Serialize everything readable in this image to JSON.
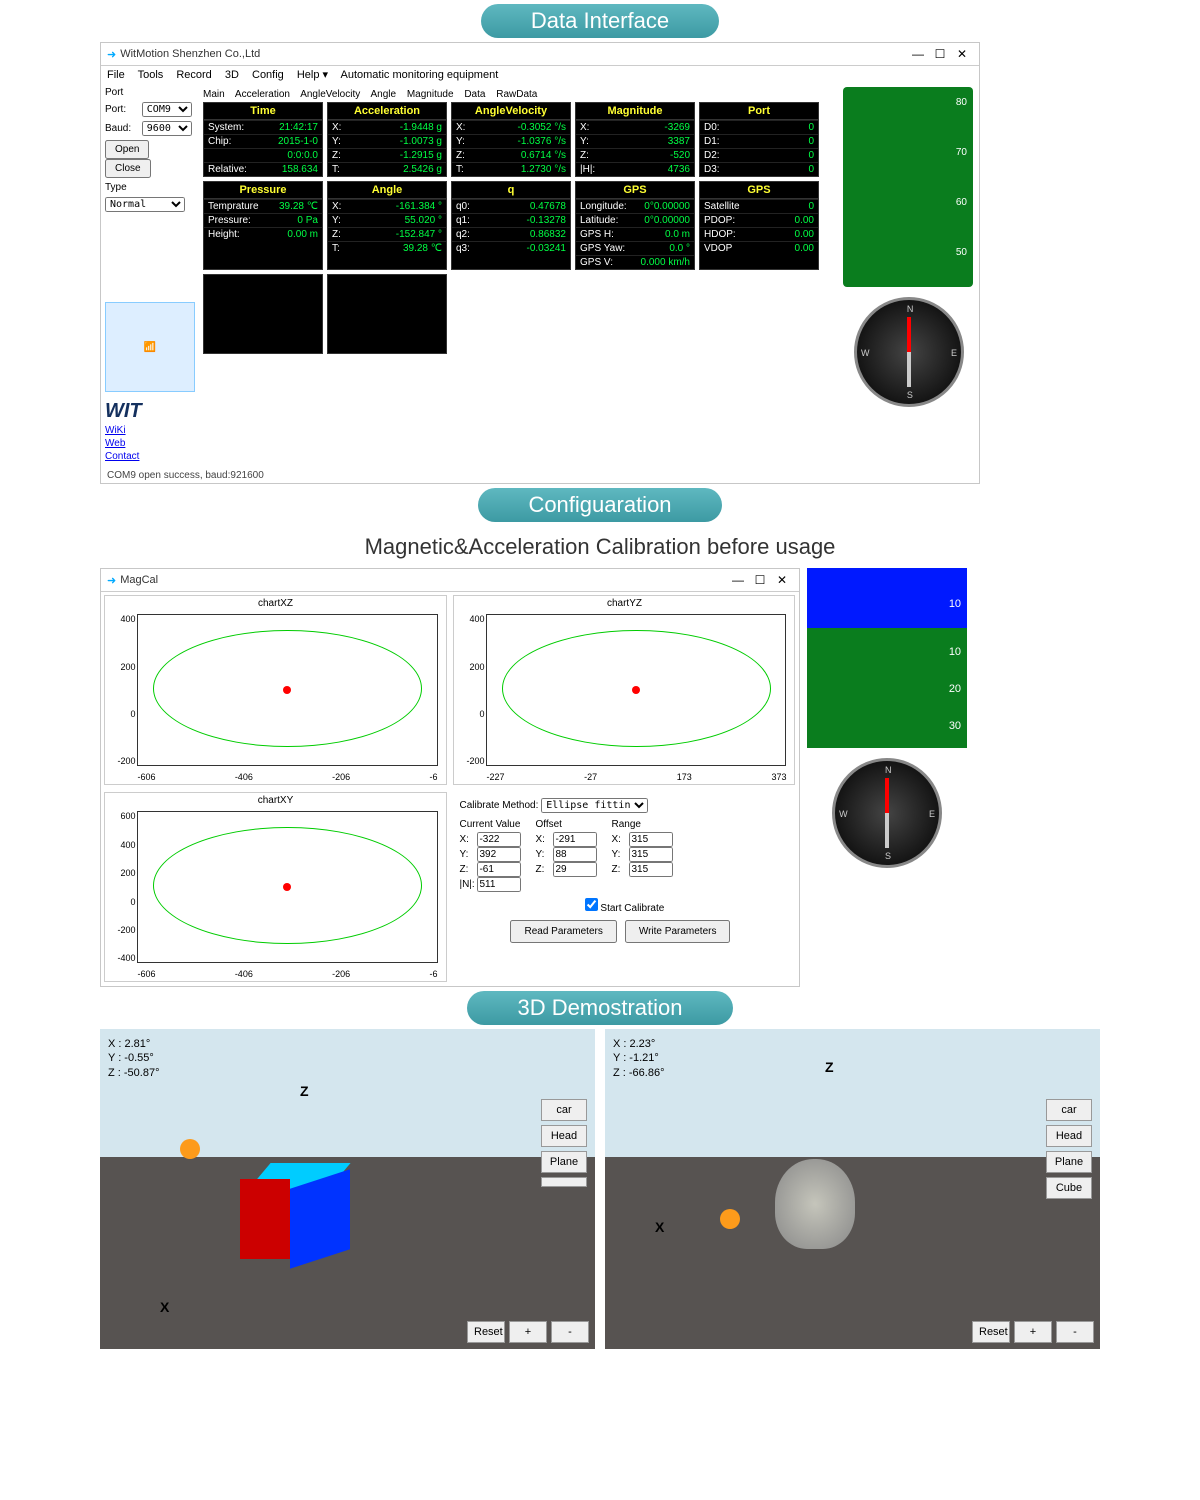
{
  "pills": {
    "data": "Data Interface",
    "config": "Configuaration",
    "demo": "3D Demostration"
  },
  "dataInterface": {
    "title": "WitMotion Shenzhen Co.,Ltd",
    "menu": [
      "File",
      "Tools",
      "Record",
      "3D",
      "Config",
      "Help ▾",
      "Automatic monitoring equipment"
    ],
    "sidebar": {
      "portLabel": "Port:",
      "port": "COM9",
      "baudLabel": "Baud:",
      "baud": "9600",
      "open": "Open",
      "close": "Close",
      "typeLabel": "Type",
      "type": "Normal",
      "wit": "WIT",
      "links": [
        "WiKi",
        "Web",
        "Contact"
      ]
    },
    "tabs": [
      "Main",
      "Acceleration",
      "AngleVelocity",
      "Angle",
      "Magnitude",
      "Data",
      "RawData"
    ],
    "panels": {
      "time": {
        "title": "Time",
        "rows": [
          [
            "System:",
            "21:42:17"
          ],
          [
            "Chip:",
            "2015-1-0"
          ],
          [
            "",
            "0:0:0.0"
          ],
          [
            "Relative:",
            "158.634"
          ]
        ]
      },
      "accel": {
        "title": "Acceleration",
        "rows": [
          [
            "X:",
            "-1.9448 g"
          ],
          [
            "Y:",
            "-1.0073 g"
          ],
          [
            "Z:",
            "-1.2915 g"
          ],
          [
            "T:",
            "2.5426 g"
          ]
        ]
      },
      "angvel": {
        "title": "AngleVelocity",
        "rows": [
          [
            "X:",
            "-0.3052 °/s"
          ],
          [
            "Y:",
            "-1.0376 °/s"
          ],
          [
            "Z:",
            "0.6714 °/s"
          ],
          [
            "T:",
            "1.2730 °/s"
          ]
        ]
      },
      "mag": {
        "title": "Magnitude",
        "rows": [
          [
            "X:",
            "-3269"
          ],
          [
            "Y:",
            "3387"
          ],
          [
            "Z:",
            "-520"
          ],
          [
            "|H|:",
            "4736"
          ]
        ]
      },
      "port": {
        "title": "Port",
        "rows": [
          [
            "D0:",
            "0"
          ],
          [
            "D1:",
            "0"
          ],
          [
            "D2:",
            "0"
          ],
          [
            "D3:",
            "0"
          ]
        ]
      },
      "pressure": {
        "title": "Pressure",
        "rows": [
          [
            "Temprature",
            "39.28 ℃"
          ],
          [
            "Pressure:",
            "0 Pa"
          ],
          [
            "Height:",
            "0.00 m"
          ]
        ]
      },
      "angle": {
        "title": "Angle",
        "rows": [
          [
            "X:",
            "-161.384 °"
          ],
          [
            "Y:",
            "55.020 °"
          ],
          [
            "Z:",
            "-152.847 °"
          ],
          [
            "T:",
            "39.28 ℃"
          ]
        ]
      },
      "q": {
        "title": "q",
        "rows": [
          [
            "q0:",
            "0.47678"
          ],
          [
            "q1:",
            "-0.13278"
          ],
          [
            "q2:",
            "0.86832"
          ],
          [
            "q3:",
            "-0.03241"
          ]
        ]
      },
      "gps1": {
        "title": "GPS",
        "rows": [
          [
            "Longitude:",
            "0°0.00000"
          ],
          [
            "Latitude:",
            "0°0.00000"
          ],
          [
            "GPS H:",
            "0.0 m"
          ],
          [
            "GPS Yaw:",
            "0.0 °"
          ],
          [
            "GPS V:",
            "0.000 km/h"
          ]
        ]
      },
      "gps2": {
        "title": "GPS",
        "rows": [
          [
            "Satellite",
            "0"
          ],
          [
            "PDOP:",
            "0.00"
          ],
          [
            "HDOP:",
            "0.00"
          ],
          [
            "VDOP",
            "0.00"
          ]
        ]
      }
    },
    "gaugeTicks": [
      "80",
      "70",
      "60",
      "50"
    ],
    "status": "COM9 open success, baud:921600"
  },
  "config": {
    "subheader": "Magnetic&Acceleration Calibration before usage",
    "magcalTitle": "MagCal",
    "charts": {
      "xz": {
        "title": "chartXZ",
        "y": [
          "400",
          "200",
          "0",
          "-200"
        ],
        "x": [
          "-606",
          "-406",
          "-206",
          "-6"
        ]
      },
      "yz": {
        "title": "chartYZ",
        "y": [
          "400",
          "200",
          "0",
          "-200"
        ],
        "x": [
          "-227",
          "-27",
          "173",
          "373"
        ]
      },
      "xy": {
        "title": "chartXY",
        "y": [
          "600",
          "400",
          "200",
          "0",
          "-200",
          "-400"
        ],
        "x": [
          "-606",
          "-406",
          "-206",
          "-6"
        ]
      }
    },
    "controls": {
      "methodLabel": "Calibrate Method:",
      "method": "Ellipse fittin",
      "curLabel": "Current Value",
      "offLabel": "Offset",
      "rngLabel": "Range",
      "cur": {
        "X": "-322",
        "Y": "392",
        "Z": "-61",
        "N": "511",
        "Nlbl": "|N|:"
      },
      "off": {
        "X": "-291",
        "Y": "88",
        "Z": "29"
      },
      "rng": {
        "X": "315",
        "Y": "315",
        "Z": "315"
      },
      "cb": "Start Calibrate",
      "read": "Read Parameters",
      "write": "Write Parameters"
    },
    "sideTicks": [
      "10",
      "10",
      "20",
      "30"
    ]
  },
  "demo": {
    "left": {
      "readout": [
        "X : 2.81°",
        "Y : -0.55°",
        "Z : -50.87°"
      ],
      "btns": [
        "car",
        "Head",
        "Plane",
        ""
      ],
      "bottom": [
        "Reset",
        "+",
        "-"
      ],
      "z": "Z",
      "x": "X"
    },
    "right": {
      "readout": [
        "X : 2.23°",
        "Y : -1.21°",
        "Z : -66.86°"
      ],
      "btns": [
        "car",
        "Head",
        "Plane",
        "Cube"
      ],
      "bottom": [
        "Reset",
        "+",
        "-"
      ],
      "z": "Z",
      "x": "X"
    }
  }
}
